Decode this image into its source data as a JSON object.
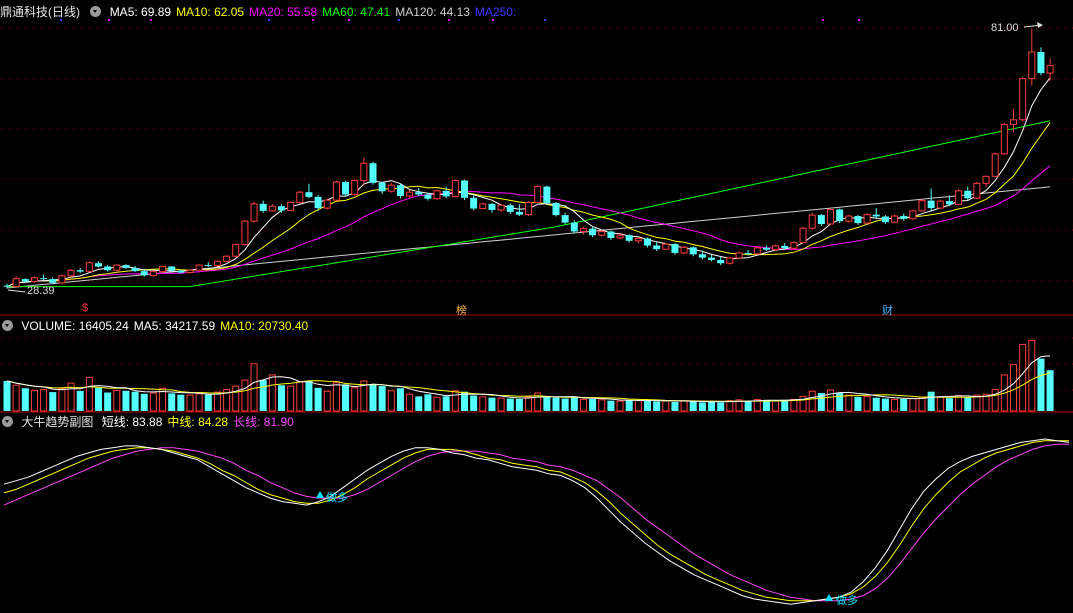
{
  "price_panel": {
    "stock_name": "鼎通科技(日线)",
    "indicators": [
      {
        "label": "MA5: 69.89",
        "color": "#ffffff"
      },
      {
        "label": "MA10: 62.05",
        "color": "#ffff00"
      },
      {
        "label": "MA20: 55.58",
        "color": "#ff00ff"
      },
      {
        "label": "MA60: 47.41",
        "color": "#00ff00"
      },
      {
        "label": "MA120: 44.13",
        "color": "#cfcfcf"
      },
      {
        "label": "MA250:",
        "color": "#3a3aff"
      }
    ],
    "high_label": "81.00",
    "low_label": "28.39",
    "markers": [
      {
        "text": "$",
        "color": "#ff3333"
      },
      {
        "text": "榜",
        "color": "#ffb040"
      },
      {
        "text": "财",
        "color": "#4db8ff"
      }
    ]
  },
  "volume_panel": {
    "indicators": [
      {
        "label": "VOLUME: 16405.24",
        "color": "#ffffff"
      },
      {
        "label": "MA5: 34217.59",
        "color": "#ffffff"
      },
      {
        "label": "MA10: 20730.40",
        "color": "#ffff00"
      }
    ]
  },
  "trend_panel": {
    "name": "大牛趋势副图",
    "indicators": [
      {
        "label": "短线: 83.88",
        "color": "#ffffff"
      },
      {
        "label": "中线: 84.28",
        "color": "#ffff00"
      },
      {
        "label": "长线: 81.90",
        "color": "#ff44ff"
      }
    ],
    "signal_label": "做多",
    "signal_color": "#00e5ff"
  },
  "colors": {
    "up": "#ff3c3c",
    "down": "#54ffff",
    "grid": "#7a0000",
    "divider": "#b00000"
  },
  "chart_data": {
    "type": "candlestick",
    "price_range": [
      28.39,
      81.0
    ],
    "candles": [
      [
        26.0,
        26.4,
        25.4,
        25.8
      ],
      [
        25.8,
        28.0,
        25.5,
        27.5
      ],
      [
        27.4,
        27.6,
        26.6,
        26.9
      ],
      [
        26.9,
        28.0,
        26.6,
        27.7
      ],
      [
        27.6,
        28.4,
        27.1,
        27.4
      ],
      [
        27.4,
        27.8,
        26.3,
        26.6
      ],
      [
        26.6,
        28.4,
        26.3,
        28.1
      ],
      [
        28.1,
        29.6,
        27.8,
        29.3
      ],
      [
        29.3,
        29.8,
        28.7,
        29.0
      ],
      [
        29.0,
        31.2,
        28.9,
        30.9
      ],
      [
        30.8,
        31.2,
        29.9,
        30.1
      ],
      [
        30.1,
        30.4,
        29.0,
        29.3
      ],
      [
        29.3,
        30.6,
        29.1,
        30.4
      ],
      [
        30.4,
        30.6,
        29.6,
        29.8
      ],
      [
        29.8,
        30.2,
        28.9,
        29.1
      ],
      [
        29.1,
        29.6,
        27.9,
        28.2
      ],
      [
        28.2,
        29.3,
        27.9,
        29.0
      ],
      [
        29.0,
        30.3,
        28.7,
        30.1
      ],
      [
        30.1,
        30.2,
        29.0,
        29.2
      ],
      [
        29.2,
        29.4,
        28.6,
        28.8
      ],
      [
        28.8,
        29.5,
        28.6,
        29.3
      ],
      [
        29.3,
        30.6,
        29.2,
        30.4
      ],
      [
        30.4,
        31.0,
        29.9,
        30.3
      ],
      [
        30.3,
        31.4,
        30.1,
        31.2
      ],
      [
        31.2,
        32.5,
        31.0,
        32.3
      ],
      [
        32.3,
        35.0,
        32.1,
        34.8
      ],
      [
        34.8,
        40.0,
        34.6,
        39.8
      ],
      [
        39.8,
        44.0,
        39.5,
        43.5
      ],
      [
        43.5,
        44.2,
        41.6,
        42.0
      ],
      [
        42.0,
        43.5,
        41.8,
        43.0
      ],
      [
        43.0,
        43.4,
        41.6,
        42.1
      ],
      [
        42.1,
        44.0,
        41.9,
        43.8
      ],
      [
        43.8,
        46.3,
        43.6,
        46.0
      ],
      [
        46.0,
        47.8,
        44.7,
        45.0
      ],
      [
        45.0,
        45.4,
        42.0,
        42.6
      ],
      [
        42.6,
        44.6,
        42.3,
        44.3
      ],
      [
        44.3,
        48.5,
        44.1,
        48.2
      ],
      [
        48.2,
        48.4,
        45.1,
        45.5
      ],
      [
        45.5,
        48.8,
        45.2,
        48.5
      ],
      [
        48.5,
        53.5,
        47.5,
        52.2
      ],
      [
        52.2,
        52.5,
        47.6,
        48.0
      ],
      [
        48.0,
        48.3,
        45.6,
        46.2
      ],
      [
        46.2,
        48.0,
        45.9,
        47.5
      ],
      [
        47.5,
        47.8,
        44.7,
        45.2
      ],
      [
        45.2,
        46.5,
        44.8,
        46.0
      ],
      [
        46.0,
        46.9,
        45.2,
        45.5
      ],
      [
        45.5,
        45.9,
        44.2,
        44.6
      ],
      [
        44.6,
        46.6,
        44.4,
        46.3
      ],
      [
        46.3,
        47.2,
        44.7,
        45.1
      ],
      [
        45.1,
        48.8,
        44.9,
        48.5
      ],
      [
        48.5,
        48.7,
        44.3,
        44.8
      ],
      [
        44.8,
        45.3,
        42.1,
        42.5
      ],
      [
        42.5,
        43.8,
        42.3,
        43.5
      ],
      [
        43.5,
        43.7,
        41.6,
        42.2
      ],
      [
        42.2,
        43.5,
        41.8,
        43.2
      ],
      [
        43.2,
        43.6,
        41.3,
        41.8
      ],
      [
        41.8,
        43.4,
        40.9,
        41.2
      ],
      [
        41.2,
        44.1,
        40.9,
        43.8
      ],
      [
        43.8,
        47.6,
        43.6,
        47.2
      ],
      [
        47.2,
        47.4,
        43.4,
        43.7
      ],
      [
        43.7,
        43.9,
        40.8,
        41.1
      ],
      [
        41.1,
        41.6,
        39.1,
        39.5
      ],
      [
        39.5,
        40.0,
        37.2,
        37.6
      ],
      [
        37.6,
        38.6,
        36.9,
        38.2
      ],
      [
        38.2,
        38.5,
        36.4,
        36.8
      ],
      [
        36.8,
        37.9,
        36.5,
        37.6
      ],
      [
        37.6,
        37.8,
        35.8,
        36.2
      ],
      [
        36.2,
        37.1,
        35.9,
        36.8
      ],
      [
        36.8,
        37.0,
        35.2,
        35.6
      ],
      [
        35.6,
        36.4,
        35.0,
        36.1
      ],
      [
        36.1,
        36.3,
        34.2,
        34.6
      ],
      [
        34.6,
        35.3,
        33.4,
        33.8
      ],
      [
        33.8,
        35.2,
        33.6,
        34.9
      ],
      [
        34.9,
        35.1,
        32.6,
        33.0
      ],
      [
        33.0,
        34.5,
        32.7,
        34.2
      ],
      [
        34.2,
        34.4,
        32.3,
        32.7
      ],
      [
        32.7,
        33.5,
        31.6,
        32.0
      ],
      [
        32.0,
        32.6,
        31.2,
        31.5
      ],
      [
        31.5,
        32.2,
        30.4,
        30.8
      ],
      [
        30.8,
        32.1,
        30.5,
        31.9
      ],
      [
        31.9,
        33.3,
        31.7,
        33.0
      ],
      [
        33.0,
        33.6,
        32.4,
        32.8
      ],
      [
        32.8,
        34.4,
        32.6,
        34.1
      ],
      [
        34.1,
        34.6,
        33.4,
        33.7
      ],
      [
        33.7,
        34.8,
        33.5,
        34.5
      ],
      [
        34.5,
        35.1,
        33.7,
        34.0
      ],
      [
        34.0,
        35.5,
        33.8,
        35.2
      ],
      [
        35.2,
        38.6,
        35.0,
        38.3
      ],
      [
        38.3,
        41.6,
        38.0,
        41.1
      ],
      [
        41.1,
        41.4,
        38.8,
        39.2
      ],
      [
        39.2,
        42.6,
        39.0,
        42.3
      ],
      [
        42.3,
        42.5,
        39.4,
        39.8
      ],
      [
        39.8,
        41.2,
        39.5,
        40.9
      ],
      [
        40.9,
        41.1,
        39.0,
        39.4
      ],
      [
        39.4,
        41.5,
        39.2,
        41.2
      ],
      [
        41.2,
        42.6,
        40.4,
        40.8
      ],
      [
        40.8,
        41.1,
        39.2,
        39.6
      ],
      [
        39.6,
        41.2,
        39.4,
        40.9
      ],
      [
        40.9,
        41.4,
        39.9,
        40.3
      ],
      [
        40.3,
        42.3,
        40.1,
        42.0
      ],
      [
        42.0,
        44.5,
        41.8,
        44.2
      ],
      [
        44.2,
        46.8,
        42.1,
        42.6
      ],
      [
        42.6,
        44.4,
        42.4,
        44.1
      ],
      [
        44.1,
        45.3,
        43.0,
        43.4
      ],
      [
        43.4,
        46.6,
        43.2,
        46.3
      ],
      [
        46.3,
        47.2,
        44.3,
        44.7
      ],
      [
        44.7,
        48.2,
        44.5,
        47.9
      ],
      [
        47.9,
        49.6,
        47.1,
        49.4
      ],
      [
        49.4,
        54.5,
        49.2,
        54.2
      ],
      [
        54.2,
        60.8,
        54.0,
        60.5
      ],
      [
        60.5,
        63.8,
        58.8,
        61.5
      ],
      [
        61.5,
        70.6,
        61.2,
        70.3
      ],
      [
        70.3,
        81.0,
        68.8,
        76.0
      ],
      [
        76.0,
        77.0,
        71.0,
        71.5
      ],
      [
        71.5,
        74.6,
        69.8,
        73.1
      ]
    ],
    "volumes": [
      [
        7000,
        "down"
      ],
      [
        6000,
        "up"
      ],
      [
        5300,
        "down"
      ],
      [
        4800,
        "up"
      ],
      [
        5000,
        "up"
      ],
      [
        4400,
        "down"
      ],
      [
        5200,
        "up"
      ],
      [
        6500,
        "up"
      ],
      [
        4700,
        "down"
      ],
      [
        7800,
        "up"
      ],
      [
        5400,
        "down"
      ],
      [
        4300,
        "down"
      ],
      [
        4800,
        "up"
      ],
      [
        4700,
        "down"
      ],
      [
        4500,
        "down"
      ],
      [
        4000,
        "down"
      ],
      [
        4200,
        "up"
      ],
      [
        5300,
        "up"
      ],
      [
        4100,
        "down"
      ],
      [
        3800,
        "down"
      ],
      [
        3700,
        "up"
      ],
      [
        4000,
        "up"
      ],
      [
        3800,
        "down"
      ],
      [
        4400,
        "up"
      ],
      [
        5000,
        "up"
      ],
      [
        5800,
        "up"
      ],
      [
        7200,
        "up"
      ],
      [
        11000,
        "up"
      ],
      [
        7200,
        "down"
      ],
      [
        8400,
        "up"
      ],
      [
        6000,
        "down"
      ],
      [
        5800,
        "up"
      ],
      [
        6800,
        "up"
      ],
      [
        7100,
        "down"
      ],
      [
        5400,
        "down"
      ],
      [
        4600,
        "up"
      ],
      [
        6600,
        "up"
      ],
      [
        6200,
        "down"
      ],
      [
        5400,
        "up"
      ],
      [
        7000,
        "up"
      ],
      [
        6100,
        "down"
      ],
      [
        5800,
        "down"
      ],
      [
        4700,
        "up"
      ],
      [
        5300,
        "down"
      ],
      [
        3900,
        "up"
      ],
      [
        3400,
        "down"
      ],
      [
        3900,
        "down"
      ],
      [
        3200,
        "up"
      ],
      [
        3400,
        "down"
      ],
      [
        4700,
        "up"
      ],
      [
        4500,
        "down"
      ],
      [
        3600,
        "down"
      ],
      [
        3300,
        "up"
      ],
      [
        3100,
        "down"
      ],
      [
        3000,
        "up"
      ],
      [
        2900,
        "down"
      ],
      [
        2800,
        "down"
      ],
      [
        3300,
        "up"
      ],
      [
        4200,
        "up"
      ],
      [
        3200,
        "down"
      ],
      [
        3100,
        "down"
      ],
      [
        2900,
        "down"
      ],
      [
        3400,
        "down"
      ],
      [
        2700,
        "up"
      ],
      [
        2800,
        "down"
      ],
      [
        2600,
        "up"
      ],
      [
        2400,
        "down"
      ],
      [
        2300,
        "up"
      ],
      [
        2500,
        "down"
      ],
      [
        2400,
        "up"
      ],
      [
        2600,
        "down"
      ],
      [
        2200,
        "down"
      ],
      [
        2300,
        "up"
      ],
      [
        2100,
        "down"
      ],
      [
        2400,
        "up"
      ],
      [
        2300,
        "down"
      ],
      [
        2000,
        "down"
      ],
      [
        2200,
        "down"
      ],
      [
        2000,
        "down"
      ],
      [
        2400,
        "up"
      ],
      [
        2600,
        "up"
      ],
      [
        2300,
        "down"
      ],
      [
        2700,
        "up"
      ],
      [
        2500,
        "down"
      ],
      [
        2400,
        "up"
      ],
      [
        2600,
        "down"
      ],
      [
        2700,
        "up"
      ],
      [
        3400,
        "up"
      ],
      [
        4600,
        "up"
      ],
      [
        4200,
        "down"
      ],
      [
        4900,
        "up"
      ],
      [
        4300,
        "down"
      ],
      [
        3700,
        "up"
      ],
      [
        3300,
        "down"
      ],
      [
        3400,
        "up"
      ],
      [
        3100,
        "down"
      ],
      [
        2900,
        "down"
      ],
      [
        2700,
        "up"
      ],
      [
        2800,
        "down"
      ],
      [
        2900,
        "up"
      ],
      [
        3200,
        "up"
      ],
      [
        4500,
        "down"
      ],
      [
        3300,
        "up"
      ],
      [
        3000,
        "down"
      ],
      [
        3600,
        "up"
      ],
      [
        3200,
        "down"
      ],
      [
        3700,
        "up"
      ],
      [
        3900,
        "up"
      ],
      [
        5000,
        "up"
      ],
      [
        8400,
        "up"
      ],
      [
        10800,
        "up"
      ],
      [
        15500,
        "up"
      ],
      [
        16400,
        "up"
      ],
      [
        12200,
        "down"
      ],
      [
        9500,
        "down"
      ]
    ],
    "trend": {
      "short": [
        70,
        72,
        74,
        77,
        80,
        83,
        86,
        88,
        90,
        91,
        92,
        92,
        91,
        90,
        88,
        86,
        84,
        80,
        76,
        72,
        68,
        65,
        62,
        60,
        59,
        58,
        60,
        63,
        68,
        73,
        78,
        82,
        86,
        89,
        91,
        91,
        90,
        88,
        87,
        85,
        84,
        82,
        80,
        79,
        78,
        76,
        75,
        72,
        68,
        62,
        55,
        48,
        42,
        36,
        31,
        26,
        22,
        18,
        15,
        12,
        9,
        6,
        4,
        3,
        2,
        1,
        2,
        3,
        4,
        5,
        8,
        14,
        22,
        32,
        44,
        56,
        66,
        73,
        79,
        83,
        86,
        88,
        90,
        92,
        94,
        95,
        96,
        95,
        94
      ],
      "medium": [
        65,
        67,
        70,
        73,
        76,
        79,
        82,
        85,
        87,
        89,
        90,
        91,
        91,
        90,
        89,
        87,
        85,
        82,
        78,
        75,
        71,
        67,
        64,
        62,
        60,
        59,
        59,
        61,
        64,
        68,
        73,
        77,
        81,
        85,
        88,
        90,
        90,
        90,
        89,
        87,
        85,
        84,
        82,
        81,
        80,
        78,
        77,
        74,
        71,
        66,
        60,
        53,
        47,
        41,
        35,
        30,
        26,
        22,
        18,
        15,
        12,
        9,
        7,
        5,
        4,
        3,
        3,
        3,
        4,
        5,
        7,
        11,
        17,
        25,
        35,
        46,
        56,
        64,
        71,
        77,
        81,
        85,
        88,
        90,
        92,
        94,
        95,
        95,
        95
      ],
      "long": [
        58,
        61,
        64,
        67,
        70,
        73,
        76,
        79,
        82,
        85,
        87,
        89,
        90,
        91,
        91,
        90,
        89,
        87,
        85,
        82,
        78,
        75,
        71,
        68,
        65,
        63,
        62,
        62,
        62,
        64,
        67,
        71,
        75,
        79,
        83,
        86,
        88,
        89,
        89,
        89,
        88,
        87,
        85,
        84,
        83,
        81,
        80,
        78,
        75,
        72,
        67,
        62,
        56,
        50,
        45,
        40,
        35,
        30,
        26,
        22,
        18,
        15,
        12,
        9,
        7,
        5,
        4,
        3,
        3,
        3,
        4,
        6,
        10,
        16,
        24,
        33,
        42,
        50,
        57,
        64,
        70,
        75,
        80,
        84,
        87,
        90,
        92,
        93,
        93
      ]
    }
  }
}
